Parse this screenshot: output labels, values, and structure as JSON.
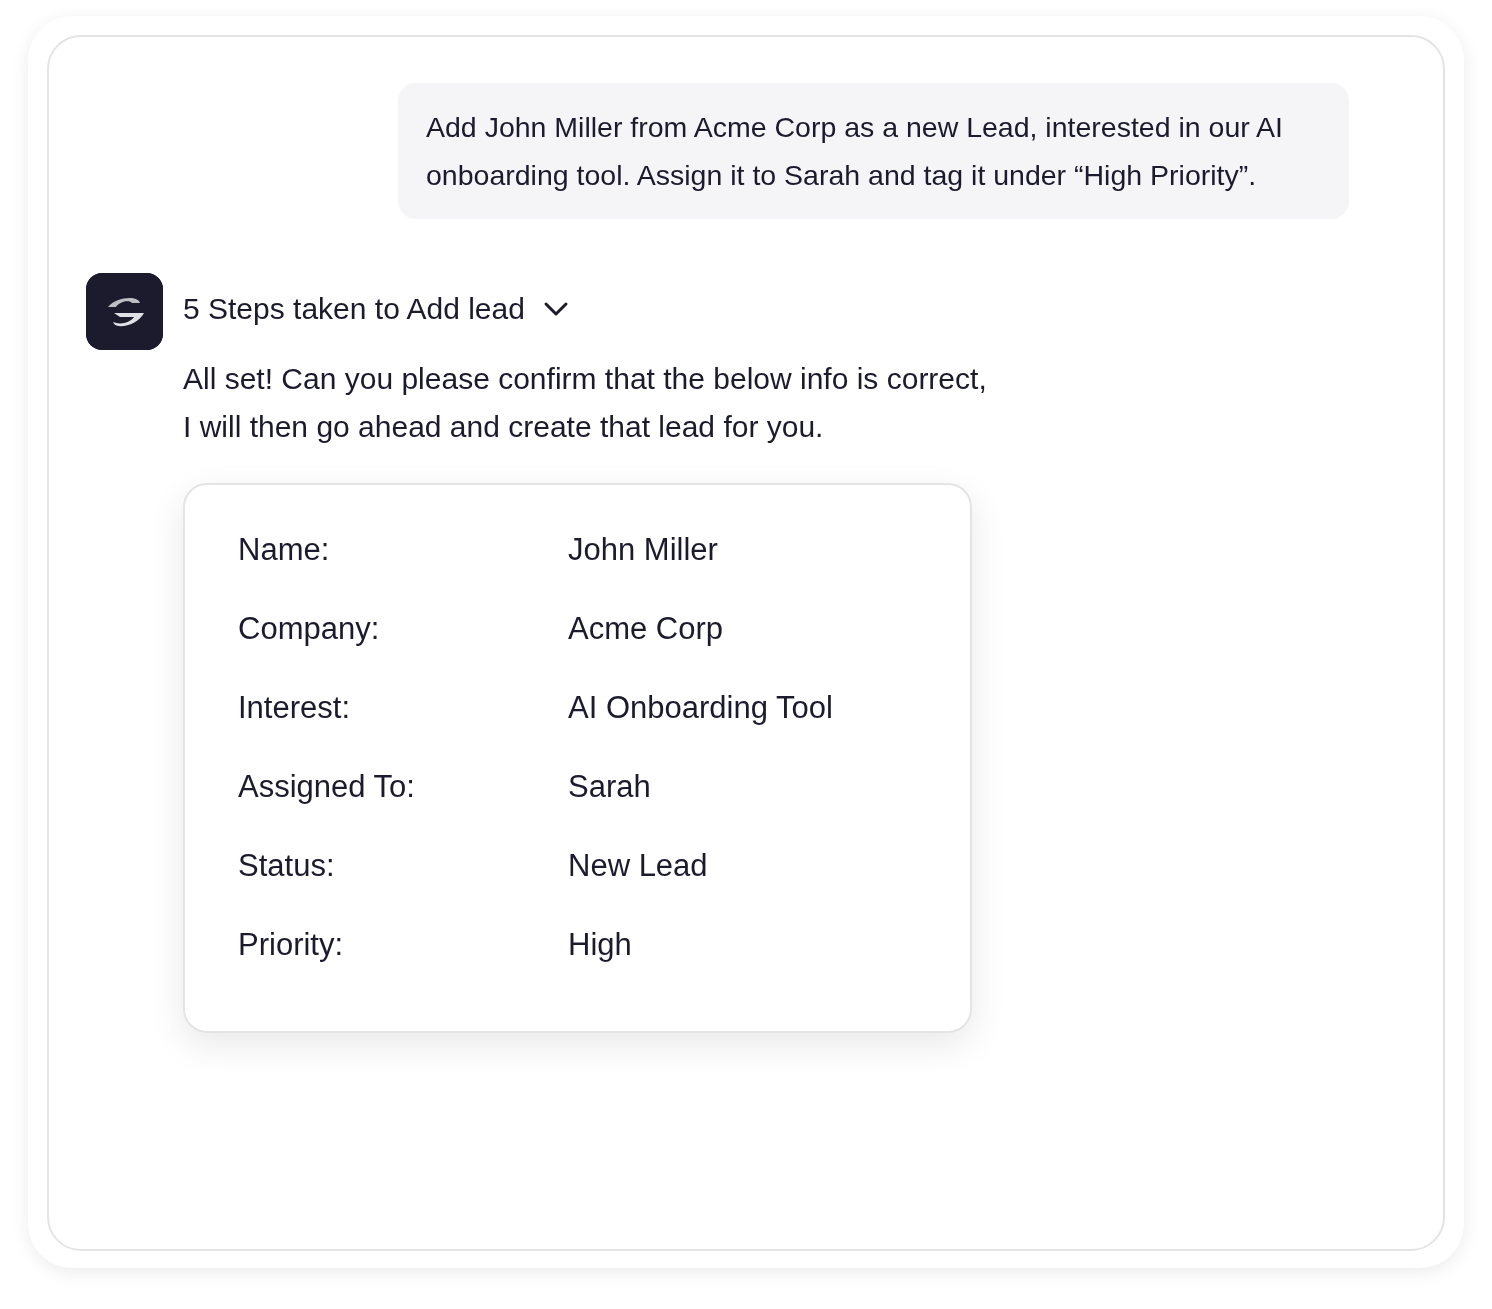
{
  "user_message": "Add John Miller from Acme Corp as a new Lead, interested in our AI onboarding tool. Assign it to Sarah and tag it under “High Priority”.",
  "steps": {
    "label": "5 Steps taken to Add lead",
    "expanded": false
  },
  "reply": "All set! Can you please confirm that the below info is correct,\nI will then go ahead and create that lead for you.",
  "lead_fields": [
    {
      "label": "Name:",
      "value": "John Miller"
    },
    {
      "label": "Company:",
      "value": "Acme Corp"
    },
    {
      "label": "Interest:",
      "value": "AI Onboarding Tool"
    },
    {
      "label": "Assigned To:",
      "value": "Sarah"
    },
    {
      "label": "Status:",
      "value": "New Lead"
    },
    {
      "label": "Priority:",
      "value": "High"
    }
  ]
}
